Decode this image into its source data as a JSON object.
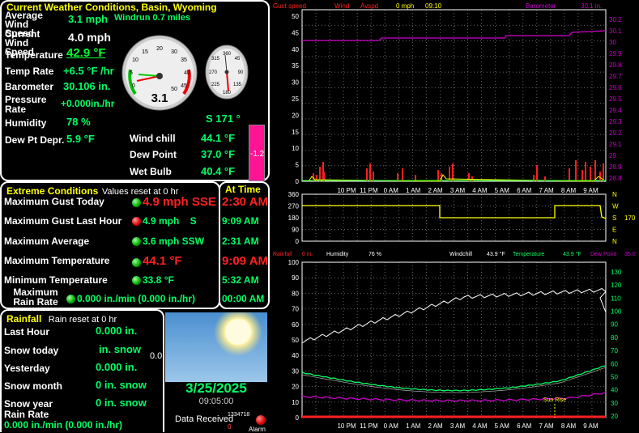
{
  "current": {
    "title": "Current Weather Conditions,  Basin, Wyoming",
    "avg_wind_label": "Average Wind Speed",
    "avg_wind_value": "3.1 mph",
    "windrun": "Windrun 0.7 miles",
    "cur_wind_label": "Current Wind Speed",
    "cur_wind_value": "4.0 mph",
    "temp_label": "Temperature",
    "temp_value": "42.9 °F",
    "temprate_label": "Temp Rate",
    "temprate_value": "+6.5 °F /hr",
    "baro_label": "Barometer",
    "baro_value": "30.106 in.",
    "press_label": "Pressure Rate",
    "press_value": "+0.000in./hr",
    "hum_label": "Humidity",
    "hum_value": "78 %",
    "dew_label": "Dew Pt Depr.",
    "dew_value": "5.9 °F",
    "dir_value": "S  171 °",
    "windchill_label": "Wind chill",
    "windchill_value": "44.1 °F",
    "dewpoint_label": "Dew Point",
    "dewpoint_value": "37.0 °F",
    "wetbulb_label": "Wet Bulb",
    "wetbulb_value": "40.4 °F",
    "temp_bar_value": "-1.2",
    "gauge_speed": "3.1",
    "gauge_ticks": [
      "5",
      "10",
      "15",
      "20",
      "25",
      "30",
      "35",
      "40",
      "45",
      "50"
    ],
    "gauge_ticks_lbl": [
      "0",
      "5",
      "15",
      "20",
      "25",
      "30",
      "35",
      "40",
      "45",
      "50"
    ],
    "compass_ticks": [
      "360",
      "45",
      "90",
      "135",
      "180",
      "225",
      "270",
      "315"
    ]
  },
  "extreme": {
    "title": "Extreme Conditions",
    "subtitle": "Values reset at 0 hr",
    "at_time": "At Time",
    "rows": [
      {
        "label": "Maximum Gust Today",
        "value": "4.9 mph SSE",
        "time": "2:30 AM"
      },
      {
        "label": "Maximum Gust Last Hour",
        "value": "4.9 mph    S",
        "time": "9:09 AM"
      },
      {
        "label": "Maximum Average",
        "value": "3.6 mph SSW",
        "time": "2:31 AM"
      },
      {
        "label": "Maximum Temperature",
        "value": "44.1 °F",
        "time": "9:09 AM"
      },
      {
        "label": "Minimum Temperature",
        "value": "33.8 °F",
        "time": "5:32 AM"
      },
      {
        "label": "Maximum Rain Rate",
        "value": "0.000 in./min (0.000 in./hr)",
        "time": "00:00 AM"
      }
    ]
  },
  "rainfall": {
    "title": "Rainfall",
    "subtitle": "Rain reset at 0 hr",
    "rows": [
      {
        "label": "Last Hour",
        "value": "0.000 in."
      },
      {
        "label": "Snow today",
        "value": "in. snow"
      },
      {
        "label": "Yesterday",
        "value": "0.000 in."
      },
      {
        "label": "Snow month",
        "value": "0 in. snow"
      },
      {
        "label": "Snow year",
        "value": "0 in. snow"
      },
      {
        "label": "Rain Rate",
        "value": "0.000 in./min (0.000 in./hr)"
      }
    ],
    "side_value": "0.0"
  },
  "status": {
    "date": "3/25/2025",
    "time": "09:05:00",
    "data_received": "Data Received",
    "counter": "1334718",
    "counter2": "0",
    "alarm": "Alarm"
  },
  "top_chart": {
    "legend": [
      "Gust speed",
      "Wind",
      "Avspd",
      "0 mph",
      "09:10",
      "Barometer",
      "30.1 in."
    ],
    "y_left": [
      "50",
      "45",
      "40",
      "35",
      "30",
      "25",
      "20",
      "15",
      "10",
      "5",
      "0"
    ],
    "y_right": [
      "30.2",
      "30.1",
      "30",
      "29.9",
      "29.8",
      "29.7",
      "29.6",
      "29.5",
      "29.4",
      "29.3",
      "29.2",
      "29.1",
      "29",
      "28.9",
      "28.8"
    ],
    "x": [
      "10 PM",
      "11 PM",
      "0 AM",
      "1 AM",
      "2 AM",
      "3 AM",
      "4 AM",
      "5 AM",
      "6 AM",
      "7 AM",
      "8 AM",
      "9 AM"
    ]
  },
  "mid_chart": {
    "y_left": [
      "360",
      "270",
      "180",
      "90",
      "0"
    ],
    "y_right": [
      "N",
      "W",
      "S",
      "E",
      "N"
    ],
    "right_value": "170",
    "x": [
      "10 PM",
      "11 PM",
      "0 AM",
      "1 AM",
      "2 AM",
      "3 AM",
      "4 AM",
      "5 AM",
      "6 AM",
      "7 AM",
      "8 AM",
      "9 AM"
    ]
  },
  "bot_chart": {
    "legend": [
      "Rainfall",
      "0 in.",
      "Humidity",
      "76 %",
      "Windchill",
      "43.9 °F",
      "Temperature",
      "43.9 °F",
      "Dew Point",
      "35.0"
    ],
    "y_left": [
      "100",
      "90",
      "80",
      "70",
      "60",
      "50",
      "40",
      "30",
      "20",
      "10",
      "0"
    ],
    "y_right": [
      "130",
      "120",
      "110",
      "100",
      "90",
      "80",
      "70",
      "60",
      "50",
      "40",
      "30",
      "20"
    ],
    "x": [
      "10 PM",
      "11 PM",
      "0 AM",
      "1 AM",
      "2 AM",
      "3 AM",
      "4 AM",
      "5 AM",
      "6 AM",
      "7 AM",
      "8 AM",
      "9 AM"
    ],
    "sunrise": "Sun Rise"
  },
  "colors": {
    "accent": "#ffff00",
    "value": "#00ff66",
    "extreme": "#ff2020",
    "baro": "#cc00cc",
    "temp": "#00ff66",
    "hum": "#ffffff",
    "dew": "#cc44cc"
  }
}
